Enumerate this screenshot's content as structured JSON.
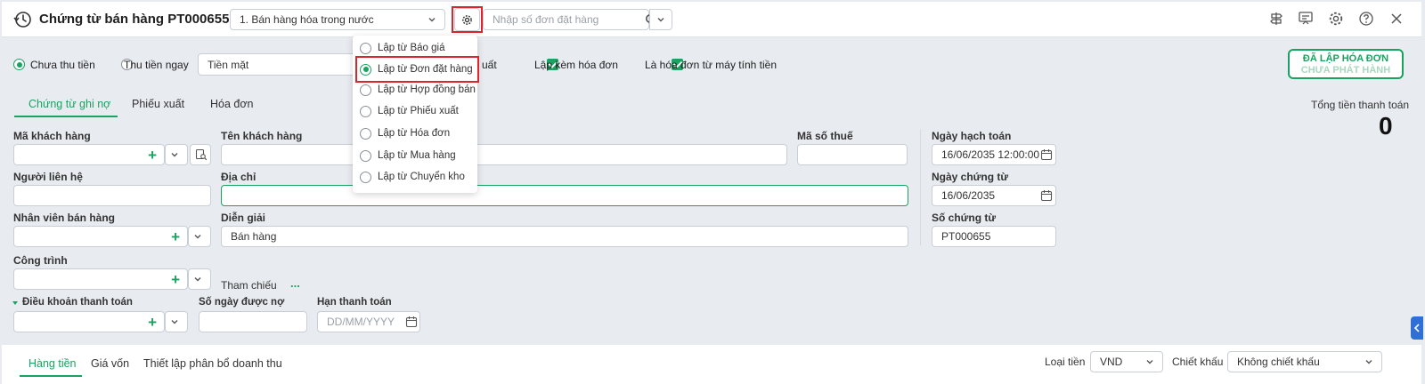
{
  "header": {
    "title": "Chứng từ bán hàng PT000655",
    "sale_type": "1. Bán hàng hóa trong nước",
    "order_search_placeholder": "Nhập số đơn đặt hàng"
  },
  "source_menu": {
    "items": [
      {
        "label": "Lập từ Báo giá",
        "selected": false
      },
      {
        "label": "Lập từ Đơn đặt hàng",
        "selected": true
      },
      {
        "label": "Lập từ Hợp đồng bán",
        "selected": false
      },
      {
        "label": "Lập từ Phiếu xuất",
        "selected": false
      },
      {
        "label": "Lập từ Hóa đơn",
        "selected": false
      },
      {
        "label": "Lập từ Mua hàng",
        "selected": false
      },
      {
        "label": "Lập từ Chuyển kho",
        "selected": false
      }
    ]
  },
  "options": {
    "unpaid": "Chưa thu tiền",
    "paid_now": "Thu tiền ngay",
    "payment_method": "Tiền mặt",
    "partial_label": "uất",
    "with_invoice": "Lập kèm hóa đơn",
    "cash_register_invoice": "Là hóa đơn từ máy tính tiền"
  },
  "status_badge": {
    "line1": "ĐÃ LẬP HÓA ĐƠN",
    "line2": "CHƯA PHÁT HÀNH"
  },
  "tabs": [
    "Chứng từ ghi nợ",
    "Phiếu xuất",
    "Hóa đơn"
  ],
  "total": {
    "label": "Tổng tiền thanh toán",
    "value": "0"
  },
  "form": {
    "customer_code_label": "Mã khách hàng",
    "customer_name_label": "Tên khách hàng",
    "tax_code_label": "Mã số thuế",
    "posting_date_label": "Ngày hạch toán",
    "posting_date_value": "16/06/2035 12:00:00",
    "contact_label": "Người liên hệ",
    "address_label": "Địa chỉ",
    "voucher_date_label": "Ngày chứng từ",
    "voucher_date_value": "16/06/2035",
    "sales_staff_label": "Nhân viên bán hàng",
    "description_label": "Diễn giải",
    "description_value": "Bán hàng",
    "voucher_no_label": "Số chứng từ",
    "voucher_no_value": "PT000655",
    "project_label": "Công trình",
    "reference_label": "Tham chiếu",
    "reference_more": "...",
    "payment_terms_label": "Điều khoản thanh toán",
    "debt_days_label": "Số ngày được nợ",
    "due_date_label": "Hạn thanh toán",
    "due_date_placeholder": "DD/MM/YYYY"
  },
  "bottom_tabs": [
    "Hàng tiền",
    "Giá vốn",
    "Thiết lập phân bổ doanh thu"
  ],
  "currency": {
    "label": "Loại tiền",
    "value": "VND"
  },
  "discount": {
    "label": "Chiết khấu",
    "value": "Không chiết khấu"
  },
  "colors": {
    "accent": "#1aa260",
    "highlight": "#d9262c"
  }
}
